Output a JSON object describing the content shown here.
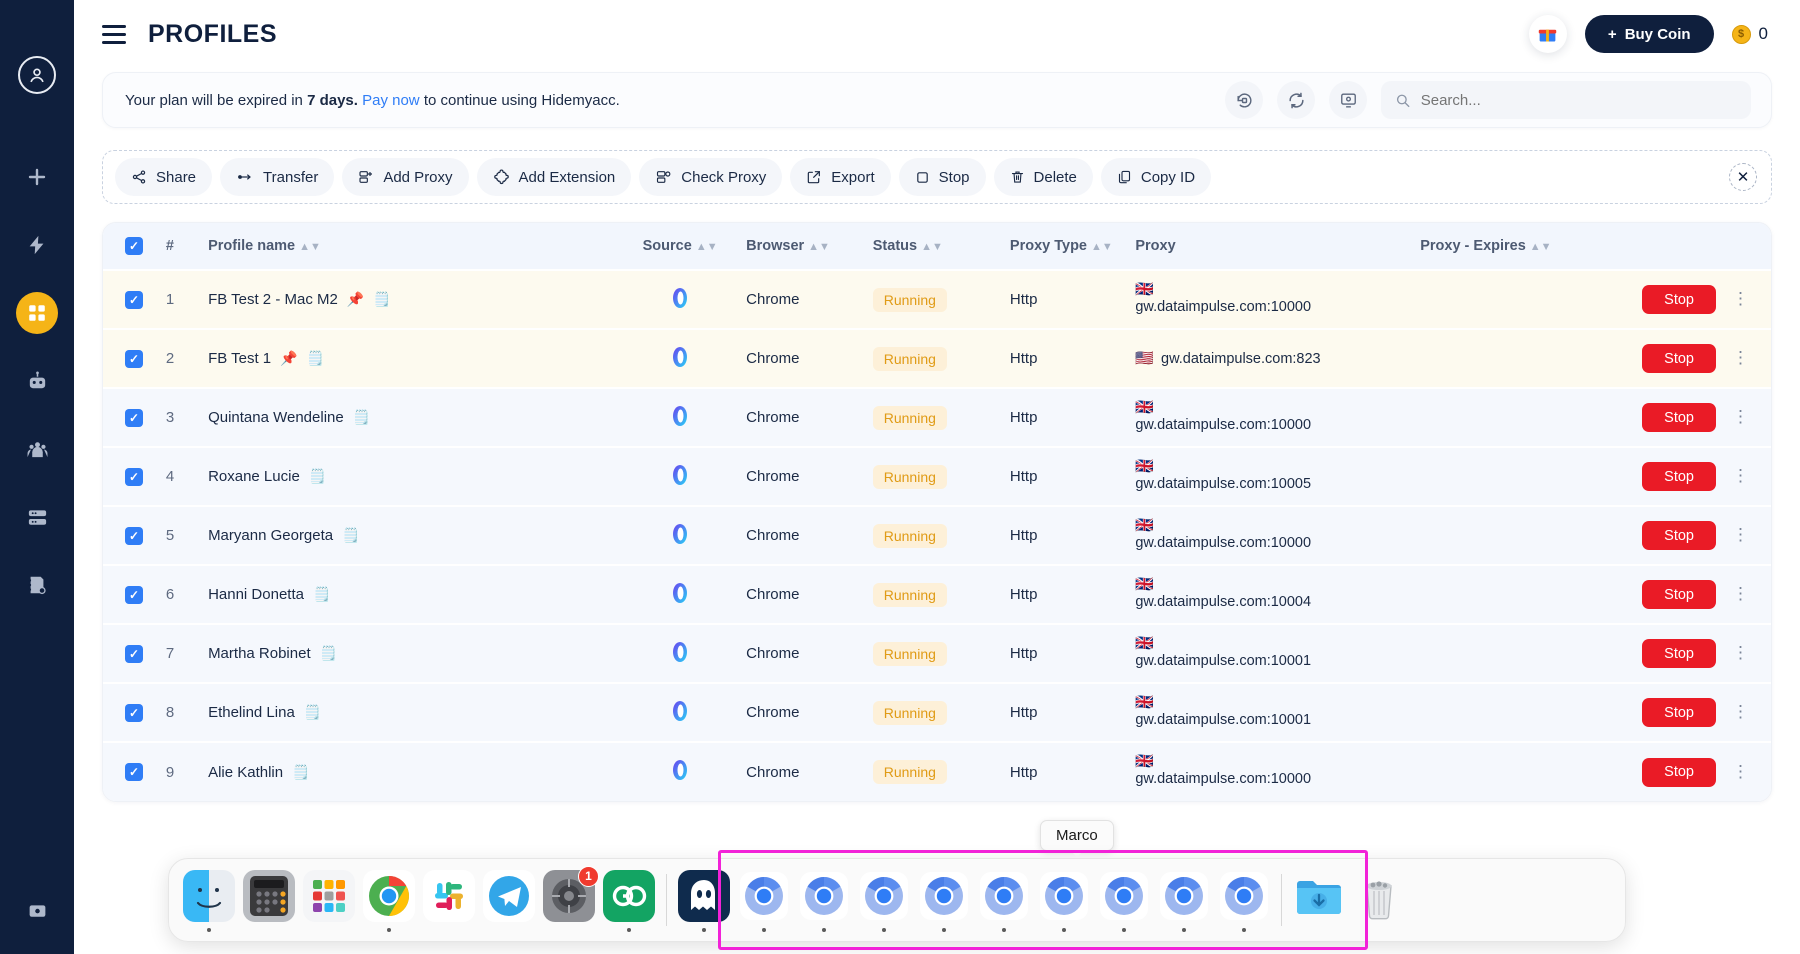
{
  "app": {
    "title": "PROFILES",
    "brand": "Hidemyacc"
  },
  "topbar": {
    "menu_icon": "hamburger-menu-icon",
    "gift_icon": "gift-icon",
    "buy_coin_label": "+ Buy Coin",
    "buy_coin_plus": "+",
    "buy_coin_text": "Buy Coin",
    "coin_symbol": "$",
    "coin_count": "0"
  },
  "banner": {
    "text_before": "Your plan will be expired in ",
    "days": "7 days.",
    "link": "Pay now",
    "text_after": " to continue using Hidemyacc.",
    "actions": [
      {
        "name": "history-icon",
        "glyph": "↺"
      },
      {
        "name": "refresh-icon",
        "glyph": "↻"
      },
      {
        "name": "screen-settings-icon",
        "glyph": "⚙"
      }
    ],
    "search_placeholder": "Search...",
    "search_value": ""
  },
  "toolbar": {
    "buttons": [
      {
        "label": "Share",
        "icon": "share-icon"
      },
      {
        "label": "Transfer",
        "icon": "transfer-icon"
      },
      {
        "label": "Add Proxy",
        "icon": "add-proxy-icon"
      },
      {
        "label": "Add Extension",
        "icon": "add-extension-icon"
      },
      {
        "label": "Check Proxy",
        "icon": "check-proxy-icon"
      },
      {
        "label": "Export",
        "icon": "export-icon"
      },
      {
        "label": "Stop",
        "icon": "stop-square-icon"
      },
      {
        "label": "Delete",
        "icon": "trash-icon"
      },
      {
        "label": "Copy ID",
        "icon": "copy-icon"
      }
    ],
    "close_label": "✕"
  },
  "table": {
    "headers": [
      {
        "label": "#",
        "sortable": false
      },
      {
        "label": "Profile name",
        "sortable": true
      },
      {
        "label": "Source",
        "sortable": true
      },
      {
        "label": "Browser",
        "sortable": true
      },
      {
        "label": "Status",
        "sortable": true
      },
      {
        "label": "Proxy Type",
        "sortable": true
      },
      {
        "label": "Proxy",
        "sortable": false
      },
      {
        "label": "Proxy - Expires",
        "sortable": true
      }
    ],
    "header_checkbox_checked": true,
    "rows": [
      {
        "num": "1",
        "name": "FB Test 2 - Mac M2",
        "pinned": true,
        "has_pin": true,
        "has_note": true,
        "source": "hidemyacc-logo",
        "browser": "Chrome",
        "status": "Running",
        "proxy_type": "Http",
        "flag": "🇬🇧",
        "proxy": "gw.dataimpulse.com:10000",
        "proxy_inline": false,
        "proxy_expires": "",
        "action": "Stop"
      },
      {
        "num": "2",
        "name": "FB Test 1",
        "pinned": true,
        "has_pin": true,
        "has_note": true,
        "source": "hidemyacc-logo",
        "browser": "Chrome",
        "status": "Running",
        "proxy_type": "Http",
        "flag": "🇺🇸",
        "proxy": "gw.dataimpulse.com:823",
        "proxy_inline": true,
        "proxy_expires": "",
        "action": "Stop"
      },
      {
        "num": "3",
        "name": "Quintana Wendeline",
        "pinned": false,
        "has_pin": false,
        "has_note": true,
        "source": "hidemyacc-logo",
        "browser": "Chrome",
        "status": "Running",
        "proxy_type": "Http",
        "flag": "🇬🇧",
        "proxy": "gw.dataimpulse.com:10000",
        "proxy_inline": false,
        "proxy_expires": "",
        "action": "Stop"
      },
      {
        "num": "4",
        "name": "Roxane Lucie",
        "pinned": false,
        "has_pin": false,
        "has_note": true,
        "source": "hidemyacc-logo",
        "browser": "Chrome",
        "status": "Running",
        "proxy_type": "Http",
        "flag": "🇬🇧",
        "proxy": "gw.dataimpulse.com:10005",
        "proxy_inline": false,
        "proxy_expires": "",
        "action": "Stop"
      },
      {
        "num": "5",
        "name": "Maryann Georgeta",
        "pinned": false,
        "has_pin": false,
        "has_note": true,
        "source": "hidemyacc-logo",
        "browser": "Chrome",
        "status": "Running",
        "proxy_type": "Http",
        "flag": "🇬🇧",
        "proxy": "gw.dataimpulse.com:10000",
        "proxy_inline": false,
        "proxy_expires": "",
        "action": "Stop"
      },
      {
        "num": "6",
        "name": "Hanni Donetta",
        "pinned": false,
        "has_pin": false,
        "has_note": true,
        "source": "hidemyacc-logo",
        "browser": "Chrome",
        "status": "Running",
        "proxy_type": "Http",
        "flag": "🇬🇧",
        "proxy": "gw.dataimpulse.com:10004",
        "proxy_inline": false,
        "proxy_expires": "",
        "action": "Stop"
      },
      {
        "num": "7",
        "name": "Martha Robinet",
        "pinned": false,
        "has_pin": false,
        "has_note": true,
        "source": "hidemyacc-logo",
        "browser": "Chrome",
        "status": "Running",
        "proxy_type": "Http",
        "flag": "🇬🇧",
        "proxy": "gw.dataimpulse.com:10001",
        "proxy_inline": false,
        "proxy_expires": "",
        "action": "Stop"
      },
      {
        "num": "8",
        "name": "Ethelind Lina",
        "pinned": false,
        "has_pin": false,
        "has_note": true,
        "source": "hidemyacc-logo",
        "browser": "Chrome",
        "status": "Running",
        "proxy_type": "Http",
        "flag": "🇬🇧",
        "proxy": "gw.dataimpulse.com:10001",
        "proxy_inline": false,
        "proxy_expires": "",
        "action": "Stop"
      },
      {
        "num": "9",
        "name": "Alie Kathlin",
        "pinned": false,
        "has_pin": false,
        "has_note": true,
        "source": "hidemyacc-logo",
        "browser": "Chrome",
        "status": "Running",
        "proxy_type": "Http",
        "flag": "🇬🇧",
        "proxy": "gw.dataimpulse.com:10000",
        "proxy_inline": false,
        "proxy_expires": "",
        "action": "Stop"
      }
    ]
  },
  "sidebar": {
    "items": [
      {
        "name": "profile-avatar-icon",
        "active": false
      },
      {
        "name": "add-icon",
        "active": false
      },
      {
        "name": "quick-actions-icon",
        "active": false
      },
      {
        "name": "profiles-grid-icon",
        "active": true
      },
      {
        "name": "automation-robot-icon",
        "active": false
      },
      {
        "name": "team-icon",
        "active": false
      },
      {
        "name": "proxy-server-icon",
        "active": false
      },
      {
        "name": "notes-icon",
        "active": false
      }
    ],
    "bottom": {
      "name": "settings-icon"
    }
  },
  "dock": {
    "tooltip": "Marco",
    "left_items": [
      {
        "name": "finder-icon",
        "label": "Finder",
        "running": true,
        "badge": ""
      },
      {
        "name": "calculator-icon",
        "label": "Calculator",
        "running": false,
        "badge": ""
      },
      {
        "name": "launchpad-icon",
        "label": "Launchpad",
        "running": false,
        "badge": ""
      },
      {
        "name": "chrome-icon",
        "label": "Google Chrome",
        "running": true,
        "badge": ""
      },
      {
        "name": "slack-icon",
        "label": "Slack",
        "running": false,
        "badge": ""
      },
      {
        "name": "telegram-icon",
        "label": "Telegram",
        "running": false,
        "badge": ""
      },
      {
        "name": "system-settings-icon",
        "label": "System Settings",
        "running": false,
        "badge": "1"
      },
      {
        "name": "goodnotes-icon",
        "label": "GoodNotes",
        "running": true,
        "badge": ""
      }
    ],
    "highlighted_items": [
      {
        "name": "hidemyacc-ghost-icon",
        "label": "Hidemyacc",
        "running": true
      },
      {
        "name": "chromium-profile-icon",
        "label": "Chromium",
        "running": true
      },
      {
        "name": "chromium-profile-icon",
        "label": "Chromium",
        "running": true
      },
      {
        "name": "chromium-profile-icon",
        "label": "Chromium",
        "running": true
      },
      {
        "name": "chromium-profile-icon",
        "label": "Chromium",
        "running": true
      },
      {
        "name": "chromium-profile-icon",
        "label": "Chromium",
        "running": true
      },
      {
        "name": "chromium-profile-icon",
        "label": "Chromium",
        "running": true
      },
      {
        "name": "chromium-profile-icon",
        "label": "Chromium",
        "running": true
      },
      {
        "name": "chromium-profile-icon",
        "label": "Chromium",
        "running": true
      },
      {
        "name": "chromium-profile-icon",
        "label": "Chromium",
        "running": true
      }
    ],
    "right_items": [
      {
        "name": "downloads-folder-icon",
        "label": "Downloads",
        "running": false
      },
      {
        "name": "trash-icon",
        "label": "Trash",
        "running": false
      }
    ],
    "highlight_color": "#f222d8"
  },
  "colors": {
    "sidebar_bg": "#0f1f3d",
    "accent_yellow": "#f5b417",
    "link_blue": "#2f7df6",
    "stop_red": "#ea1b26",
    "status_amber": "#e09b16",
    "pinned_row": "#fdfaef",
    "normal_row": "#f5f8fd"
  }
}
